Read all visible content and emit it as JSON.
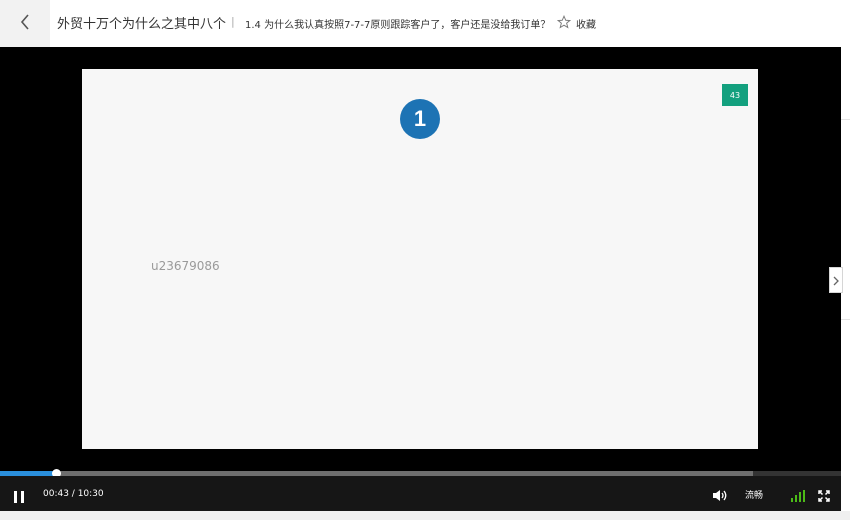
{
  "header": {
    "course_title": "外贸十万个为什么之其中八个",
    "separator": "|",
    "lesson_title": "1.4 为什么我认真按照7-7-7原则跟踪客户了，客户还是没给我订单？",
    "favorite_label": "收藏"
  },
  "slide": {
    "step_number": "1",
    "page_badge": "43",
    "watermark": "u23679086"
  },
  "player": {
    "time_text": "00:43 / 10:30",
    "quality_label": "流畅",
    "progress_fraction": 0.067,
    "buffered_fraction": 0.895
  },
  "colors": {
    "accent_blue": "#1d73b4",
    "badge_green": "#13a07e",
    "progress_blue": "#2a8fdc",
    "signal_green": "#4cbb17"
  }
}
